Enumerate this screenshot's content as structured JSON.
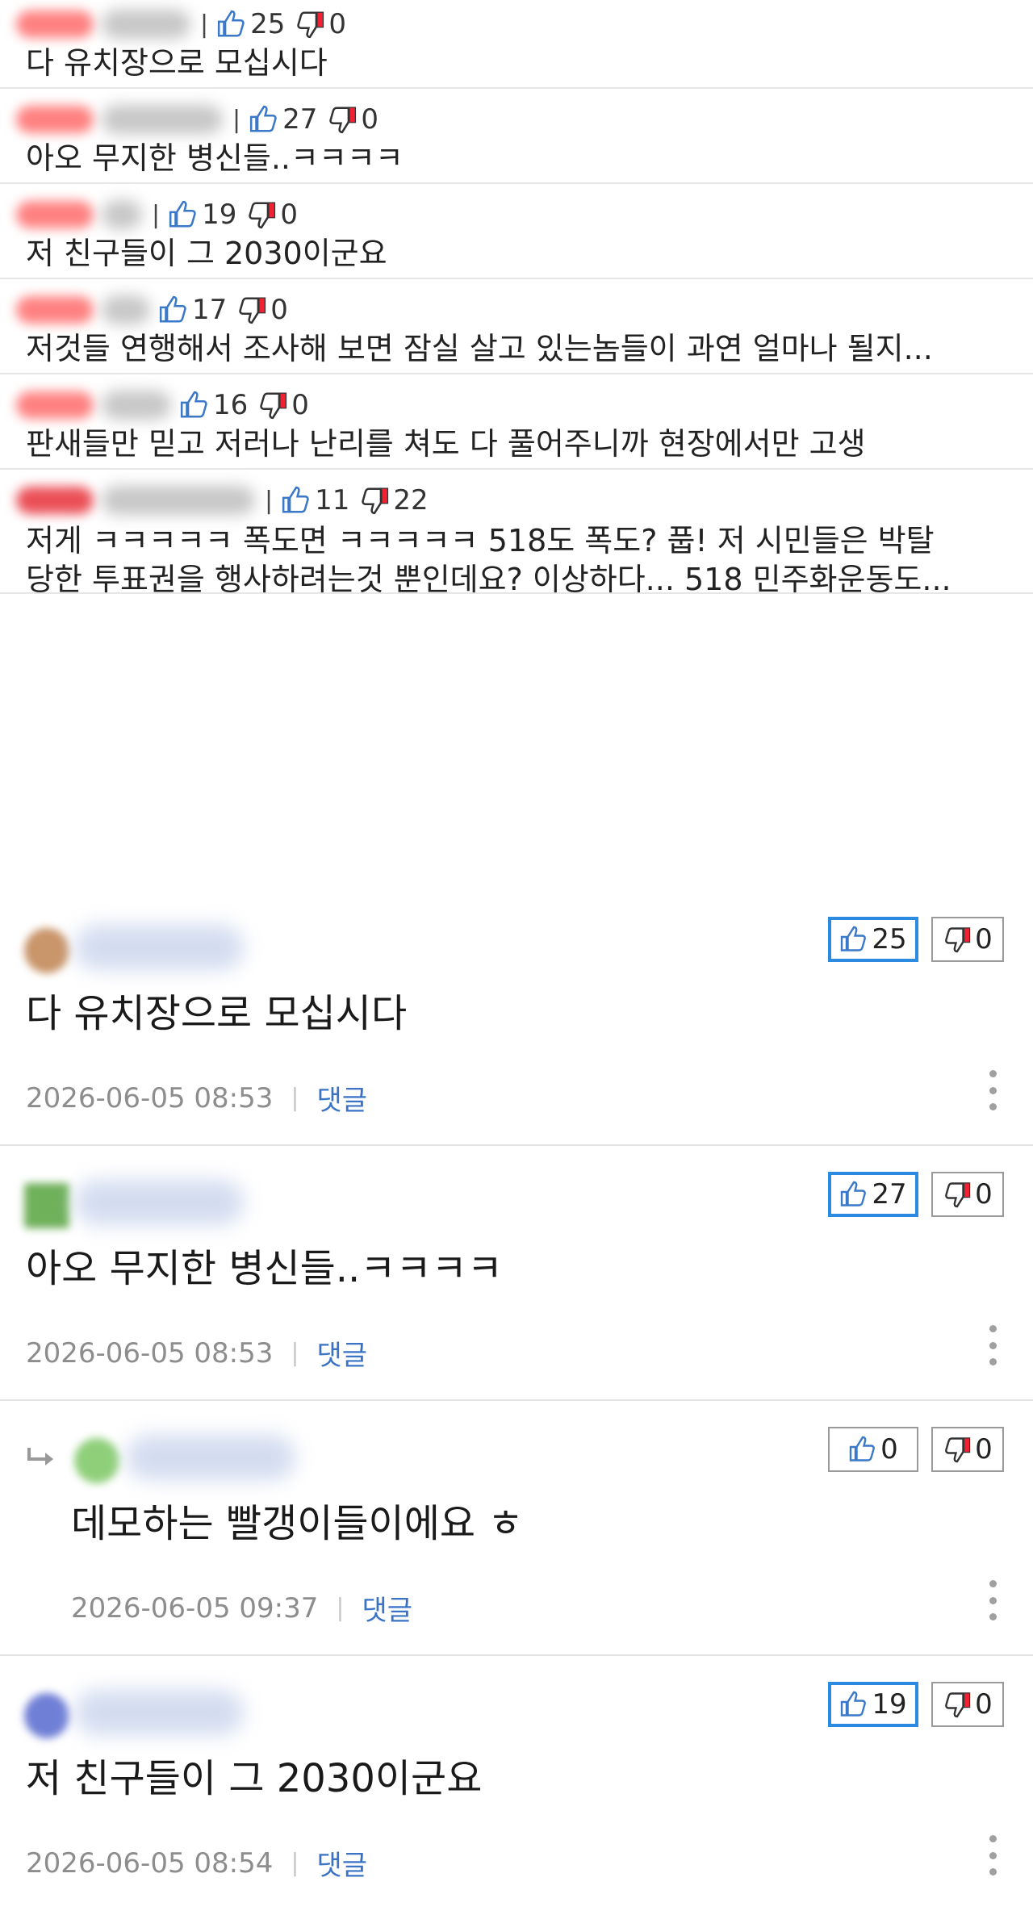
{
  "compact_comments": [
    {
      "likes": "25",
      "dislikes": "0",
      "text": "다 유치장으로 모십시다"
    },
    {
      "likes": "27",
      "dislikes": "0",
      "text": "아오 무지한 병신들..ㅋㅋㅋㅋ"
    },
    {
      "likes": "19",
      "dislikes": "0",
      "text": "저 친구들이 그 2030이군요"
    },
    {
      "likes": "17",
      "dislikes": "0",
      "text": "저것들 연행해서 조사해 보면 잠실 살고 있는놈들이 과연 얼마나 될지..."
    },
    {
      "likes": "16",
      "dislikes": "0",
      "text": "판새들만 믿고 저러나 난리를 쳐도 다 풀어주니까 현장에서만 고생"
    },
    {
      "likes": "11",
      "dislikes": "22",
      "text_line1": "저게 ㅋㅋㅋㅋㅋ 폭도면 ㅋㅋㅋㅋㅋ 518도 폭도? 풉! 저 시민들은 박탈",
      "text_line2": "당한 투표권을 행사하려는것 뿐인데요? 이상하다... 518 민주화운동도..."
    }
  ],
  "comments": [
    {
      "body": "다 유치장으로 모십시다",
      "date": "2026-06-05 08:53",
      "reply_label": "댓글",
      "likes": "25",
      "dislikes": "0"
    },
    {
      "body": "아오 무지한 병신들..ㅋㅋㅋㅋ",
      "date": "2026-06-05 08:53",
      "reply_label": "댓글",
      "likes": "27",
      "dislikes": "0"
    },
    {
      "body": "데모하는 빨갱이들이에요 ㅎ",
      "date": "2026-06-05 09:37",
      "reply_label": "댓글",
      "likes": "0",
      "dislikes": "0"
    },
    {
      "body": "저 친구들이 그 2030이군요",
      "date": "2026-06-05 08:54",
      "reply_label": "댓글",
      "likes": "19",
      "dislikes": "0"
    }
  ],
  "colors": {
    "accent_blue": "#2b8be0",
    "reply_link": "#3a72c5",
    "avatar_red": "#ff6b6b"
  },
  "icons": {
    "like": "thumbs-up-icon",
    "dislike": "thumbs-down-icon",
    "reply": "reply-arrow-icon",
    "more": "more-vertical-icon"
  }
}
